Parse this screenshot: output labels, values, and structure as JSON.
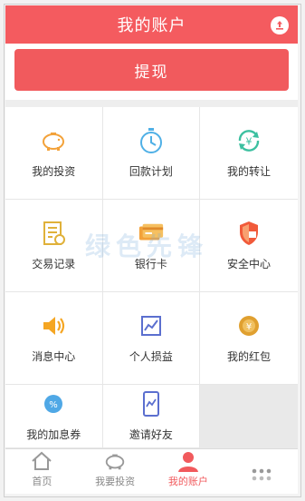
{
  "header": {
    "title": "我的账户"
  },
  "withdraw": {
    "label": "提现"
  },
  "grid": {
    "items": [
      {
        "label": "我的投资",
        "icon": "piggy-bank-icon",
        "color": "#f3a23a"
      },
      {
        "label": "回款计划",
        "icon": "stopwatch-icon",
        "color": "#4fb0e6"
      },
      {
        "label": "我的转让",
        "icon": "yen-transfer-icon",
        "color": "#3cc0a0"
      },
      {
        "label": "交易记录",
        "icon": "receipt-icon",
        "color": "#e0b13a"
      },
      {
        "label": "银行卡",
        "icon": "bank-card-icon",
        "color": "#f3a23a"
      },
      {
        "label": "安全中心",
        "icon": "shield-icon",
        "color": "#f15a3a"
      },
      {
        "label": "消息中心",
        "icon": "speaker-icon",
        "color": "#f5a623"
      },
      {
        "label": "个人损益",
        "icon": "chart-icon",
        "color": "#5b6fcf"
      },
      {
        "label": "我的红包",
        "icon": "gift-icon",
        "color": "#e0a030"
      },
      {
        "label": "我的加息券",
        "icon": "percent-coupon-icon",
        "color": "#4fa8e6"
      },
      {
        "label": "邀请好友",
        "icon": "phone-invite-icon",
        "color": "#5b6fcf"
      }
    ]
  },
  "watermark": "绿色先锋",
  "tabbar": {
    "tabs": [
      {
        "label": "首页",
        "icon": "home-icon"
      },
      {
        "label": "我要投资",
        "icon": "piggy-bank-icon"
      },
      {
        "label": "我的账户",
        "icon": "user-icon"
      },
      {
        "label": "",
        "icon": "more-icon"
      }
    ],
    "active_index": 2,
    "active_color": "#f15a5d"
  },
  "colors": {
    "brand": "#f15a5d",
    "header": "#f45b5f"
  }
}
